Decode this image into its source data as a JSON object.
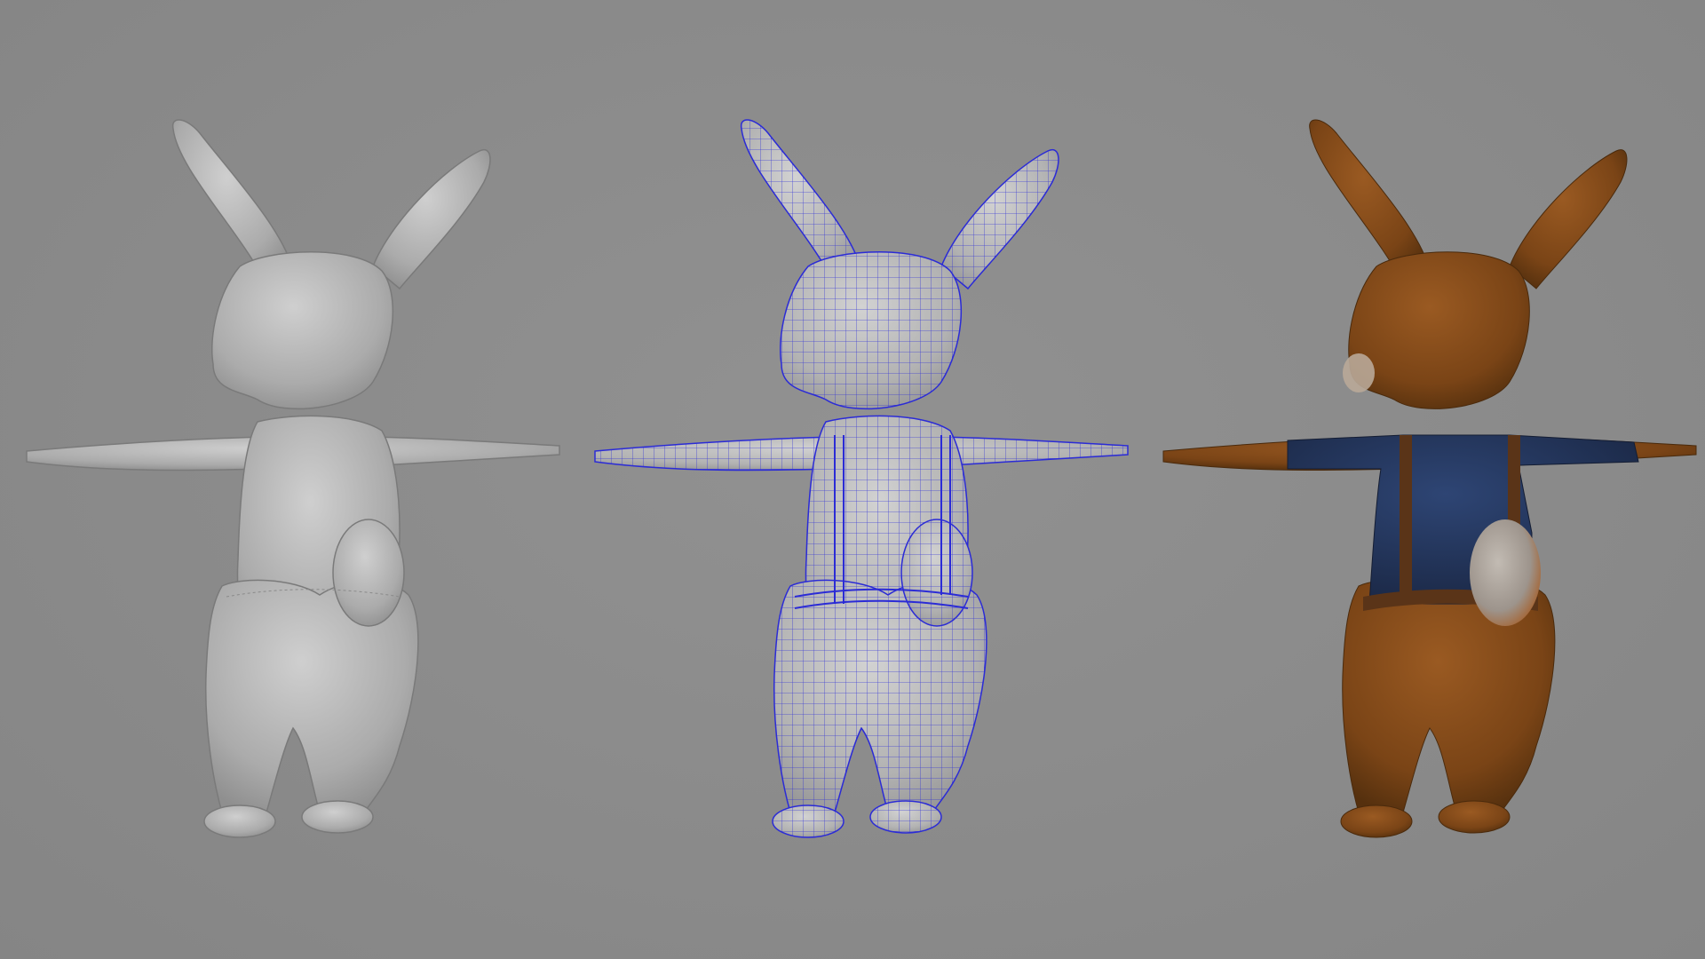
{
  "scene": {
    "background_color": "#8b8b8b",
    "models": [
      {
        "id": "solid",
        "shading": "smooth-shaded",
        "body_color": "#b4b4b4"
      },
      {
        "id": "wire",
        "shading": "wireframe-on-shaded",
        "body_color": "#b9b9b9",
        "wire_color": "#2b2bd6"
      },
      {
        "id": "textured",
        "shading": "textured",
        "body_color": "#7a4416",
        "shirt_color": "#22345a",
        "strap_color": "#5a3418",
        "tail_color": "#a39a93"
      }
    ]
  }
}
